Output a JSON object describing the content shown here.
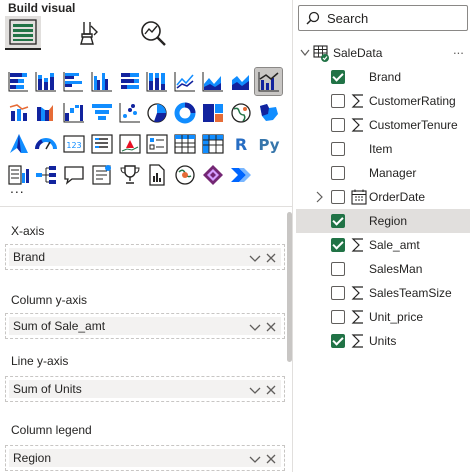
{
  "pane_title": "Build visual",
  "mode_tabs": [
    {
      "label": "Build visual",
      "icon": "build-visual-icon",
      "selected": true
    },
    {
      "label": "Format visual",
      "icon": "format-brush-icon",
      "selected": false
    },
    {
      "label": "Analytics",
      "icon": "analytics-magnifier-icon",
      "selected": false
    }
  ],
  "visualizations": [
    [
      "stacked-bar-chart-icon",
      "stacked-column-chart-icon",
      "clustered-bar-chart-icon",
      "clustered-column-chart-icon",
      "100-stacked-bar-chart-icon",
      "100-stacked-column-chart-icon",
      "line-chart-icon",
      "area-chart-icon",
      "stacked-area-chart-icon",
      "line-and-clustered-column-chart-icon"
    ],
    [
      "line-and-stacked-column-chart-icon",
      "ribbon-chart-icon",
      "waterfall-chart-icon",
      "funnel-chart-icon",
      "scatter-chart-icon",
      "pie-chart-icon",
      "donut-chart-icon",
      "treemap-icon",
      "map-icon",
      "filled-map-icon"
    ],
    [
      "azure-map-icon",
      "gauge-icon",
      "card-icon",
      "multi-row-card-icon",
      "kpi-icon",
      "slicer-icon",
      "table-icon",
      "matrix-icon",
      "r-script-visual-icon",
      "python-visual-icon"
    ],
    [
      "key-influencers-icon",
      "decomposition-tree-icon",
      "qa-icon",
      "smart-narrative-icon",
      "metrics-icon",
      "paginated-report-icon",
      "arcgis-map-icon",
      "power-apps-icon",
      "power-automate-icon",
      ""
    ]
  ],
  "more_visuals_label": "...",
  "field_wells": [
    {
      "label": "X-axis",
      "value": "Brand"
    },
    {
      "label": "Column y-axis",
      "value": "Sum of Sale_amt"
    },
    {
      "label": "Line y-axis",
      "value": "Sum of Units"
    },
    {
      "label": "Column legend",
      "value": "Region"
    }
  ],
  "search": {
    "placeholder": "Search"
  },
  "table": {
    "name": "SaleData",
    "more_label": "...",
    "expanded": true
  },
  "fields": [
    {
      "name": "Brand",
      "checked": true,
      "type": "",
      "selected": false
    },
    {
      "name": "CustomerRating",
      "checked": false,
      "type": "sigma",
      "selected": false
    },
    {
      "name": "CustomerTenure",
      "checked": false,
      "type": "sigma",
      "selected": false
    },
    {
      "name": "Item",
      "checked": false,
      "type": "",
      "selected": false
    },
    {
      "name": "Manager",
      "checked": false,
      "type": "",
      "selected": false
    },
    {
      "name": "OrderDate",
      "checked": false,
      "type": "calendar",
      "selected": false,
      "expandable": true
    },
    {
      "name": "Region",
      "checked": true,
      "type": "",
      "selected": true
    },
    {
      "name": "Sale_amt",
      "checked": true,
      "type": "sigma",
      "selected": false
    },
    {
      "name": "SalesMan",
      "checked": false,
      "type": "",
      "selected": false
    },
    {
      "name": "SalesTeamSize",
      "checked": false,
      "type": "sigma",
      "selected": false
    },
    {
      "name": "Unit_price",
      "checked": false,
      "type": "sigma",
      "selected": false
    },
    {
      "name": "Units",
      "checked": true,
      "type": "sigma",
      "selected": false
    }
  ],
  "colors": {
    "accent_green": "#217346",
    "selected_bg": "#e1dfdd",
    "chart_blue": "#118dff",
    "chart_navy": "#12239e",
    "chart_orange": "#e66c37"
  }
}
